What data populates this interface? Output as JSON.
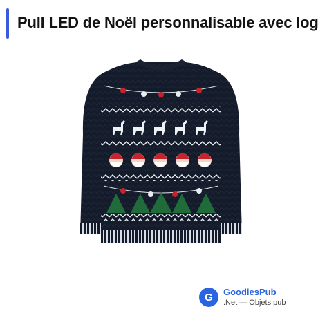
{
  "header": {
    "title": "Pull LED de Noël personnalisable avec logo"
  },
  "product": {
    "image_icon": "christmas-sweater-photo"
  },
  "brand": {
    "logo_letter": "G",
    "name": "GoodiesPub",
    "subtitle": ".Net — Objets pub",
    "color": "#2b64e0"
  },
  "colors": {
    "accent": "#3a5bd9",
    "sweater": "#141b2a",
    "red": "#c8232c",
    "green": "#1f6b3a",
    "white": "#ffffff"
  }
}
